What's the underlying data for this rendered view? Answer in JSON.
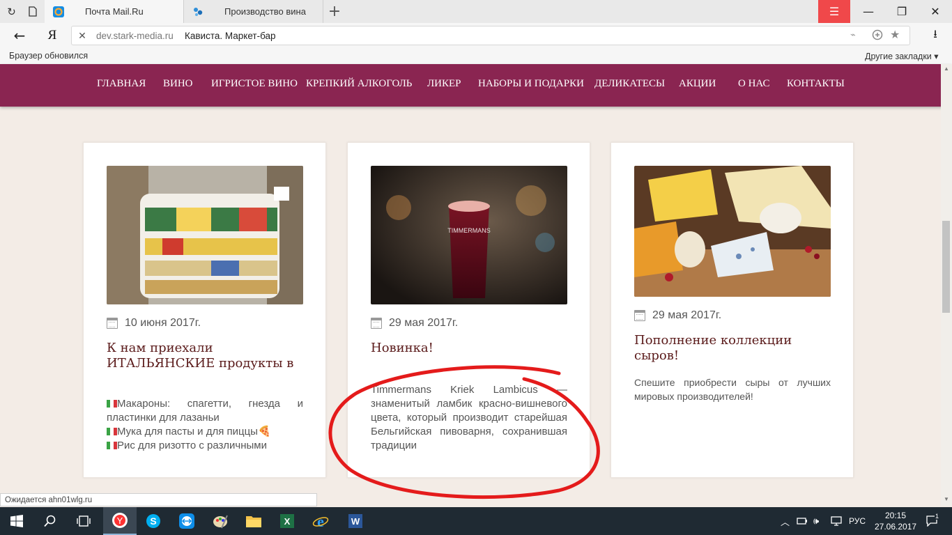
{
  "browser": {
    "tabs": [
      {
        "label": "Почта Mail.Ru",
        "icon": "mail-ru-icon"
      },
      {
        "label": "Производство вина",
        "icon": "star-sparkle-icon"
      }
    ],
    "domain": "dev.stark-media.ru",
    "page_title": "Кависта. Маркет-бар",
    "yandex_logo": "Я",
    "bookmarks": {
      "left": "Браузер обновился",
      "right": "Другие закладки ▾"
    },
    "accent": "#f0484a"
  },
  "site": {
    "nav_color": "#8a2551",
    "nav": [
      "ГЛАВНАЯ",
      "ВИНО",
      "ИГРИСТОЕ ВИНО",
      "КРЕПКИЙ АЛКОГОЛЬ",
      "ЛИКЕР",
      "НАБОРЫ И ПОДАРКИ",
      "ДЕЛИКАТЕСЫ",
      "АКЦИИ",
      "О НАС",
      "КОНТАКТЫ"
    ],
    "cards": [
      {
        "date": "10 июня 2017г.",
        "title": "К нам приехали ИТАЛЬЯНСКИЕ продукты в",
        "lines": [
          "Макароны: спагетти, гнезда и пластинки для лазаньи",
          "Мука для пасты и для пиццы🍕",
          "Рис для ризотто с различными"
        ]
      },
      {
        "date": "29 мая 2017г.",
        "title": "Новинка!",
        "body": "Timmermans Kriek Lambicus — знаменитый ламбик красно-вишневого цвета, который производит старейшая Бельгийская пивоварня, сохранившая традиции",
        "glass_text": "TIMMERMANS"
      },
      {
        "date": "29 мая 2017г.",
        "title": "Пополнение коллекции сыров!",
        "body": "Спешите приобрести сыры от лучших мировых производителей!"
      }
    ]
  },
  "status_text": "Ожидается ahn01wlg.ru",
  "taskbar": {
    "lang": "РУС",
    "time": "20:15",
    "date": "27.06.2017",
    "notification_count": "1"
  }
}
